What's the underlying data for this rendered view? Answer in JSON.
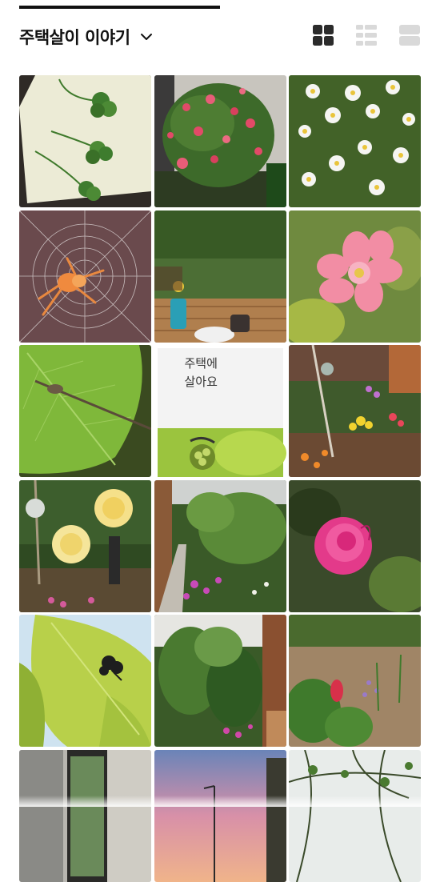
{
  "header": {
    "title": "주택살이 이야기",
    "dropdown_icon": "chevron-down-icon",
    "view_modes": [
      {
        "name": "grid-view-icon",
        "selected": true
      },
      {
        "name": "card-list-view-icon",
        "selected": false
      },
      {
        "name": "list-view-icon",
        "selected": false
      }
    ]
  },
  "posts": [
    {
      "subject": "clover leaves on paper"
    },
    {
      "subject": "pink flowering shrub"
    },
    {
      "subject": "white daisies"
    },
    {
      "subject": "spider on web"
    },
    {
      "subject": "deck garden with coffee"
    },
    {
      "subject": "pink zinnia"
    },
    {
      "subject": "damselfly on leaf"
    },
    {
      "subject": "text card",
      "card_text": "주택에\n살아요"
    },
    {
      "subject": "colorful flower garden"
    },
    {
      "subject": "yellow roses"
    },
    {
      "subject": "garden path"
    },
    {
      "subject": "pink rose"
    },
    {
      "subject": "beetle on leaves"
    },
    {
      "subject": "trees beside house"
    },
    {
      "subject": "red tulip in bed"
    },
    {
      "subject": "window view"
    },
    {
      "subject": "sunset with street lamp"
    },
    {
      "subject": "tree branches"
    }
  ],
  "colors": {
    "accent": "#111111",
    "icon_inactive": "#d9d9d9"
  }
}
